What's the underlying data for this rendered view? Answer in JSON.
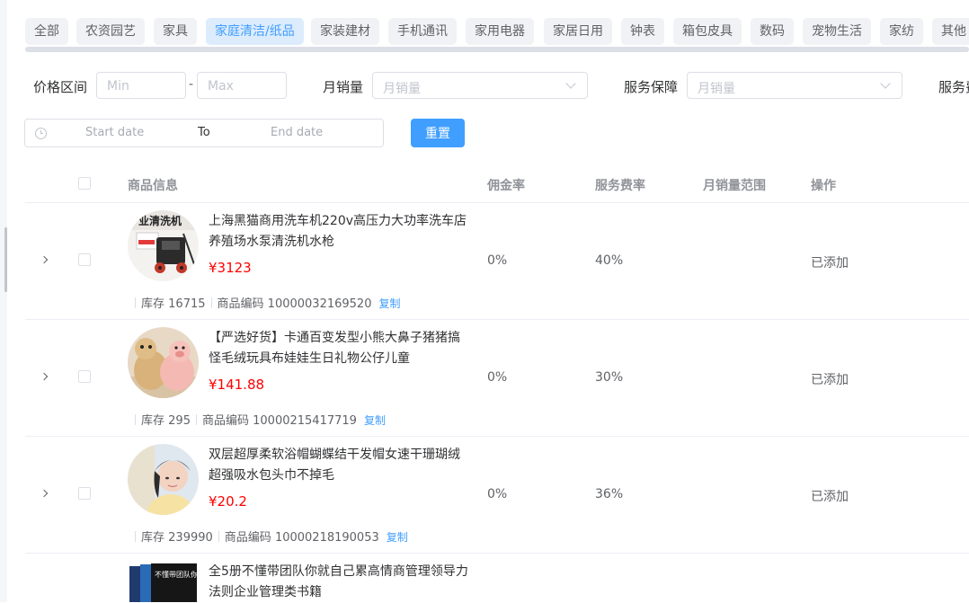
{
  "categories": [
    {
      "label": "全部",
      "active": false
    },
    {
      "label": "农资园艺",
      "active": false
    },
    {
      "label": "家具",
      "active": false
    },
    {
      "label": "家庭清洁/纸品",
      "active": true
    },
    {
      "label": "家装建材",
      "active": false
    },
    {
      "label": "手机通讯",
      "active": false
    },
    {
      "label": "家用电器",
      "active": false
    },
    {
      "label": "家居日用",
      "active": false
    },
    {
      "label": "钟表",
      "active": false
    },
    {
      "label": "箱包皮具",
      "active": false
    },
    {
      "label": "数码",
      "active": false
    },
    {
      "label": "宠物生活",
      "active": false
    },
    {
      "label": "家纺",
      "active": false
    },
    {
      "label": "其他",
      "active": false
    }
  ],
  "filters": {
    "price_label": "价格区间",
    "price_min_placeholder": "Min",
    "price_dash": "-",
    "price_max_placeholder": "Max",
    "sales_label": "月销量",
    "sales_placeholder": "月销量",
    "service_label": "服务保障",
    "service_placeholder": "月销量",
    "service_fee_label": "服务费",
    "start_placeholder": "Start date",
    "to_label": "To",
    "end_placeholder": "End date",
    "reset_label": "重置"
  },
  "table": {
    "headers": {
      "product": "商品信息",
      "commission": "佣金率",
      "service_rate": "服务费率",
      "sales_range": "月销量范围",
      "action": "操作"
    },
    "rows": [
      {
        "name": "上海黑猫商用洗车机220v高压力大功率洗车店养殖场水泵清洗机水枪",
        "price": "¥3123",
        "stock_label": "库存",
        "stock": "16715",
        "code_label": "商品编码",
        "code": "10000032169520",
        "copy_label": "复制",
        "commission": "0%",
        "service_rate": "40%",
        "sales_range": "",
        "action": "已添加",
        "thumb_text": "业清洗机"
      },
      {
        "name": "【严选好货】卡通百变发型小熊大鼻子猪猪搞怪毛绒玩具布娃娃生日礼物公仔儿童",
        "price": "¥141.88",
        "stock_label": "库存",
        "stock": "295",
        "code_label": "商品编码",
        "code": "10000215417719",
        "copy_label": "复制",
        "commission": "0%",
        "service_rate": "30%",
        "sales_range": "",
        "action": "已添加"
      },
      {
        "name": "双层超厚柔软浴帽蝴蝶结干发帽女速干珊瑚绒超强吸水包头巾不掉毛",
        "price": "¥20.2",
        "stock_label": "库存",
        "stock": "239990",
        "code_label": "商品编码",
        "code": "10000218190053",
        "copy_label": "复制",
        "commission": "0%",
        "service_rate": "36%",
        "sales_range": "",
        "action": "已添加"
      },
      {
        "name": "全5册不懂带团队你就自己累高情商管理领导力法则企业管理类书籍",
        "thumb_text": "不懂带团队你就自己累"
      }
    ]
  }
}
